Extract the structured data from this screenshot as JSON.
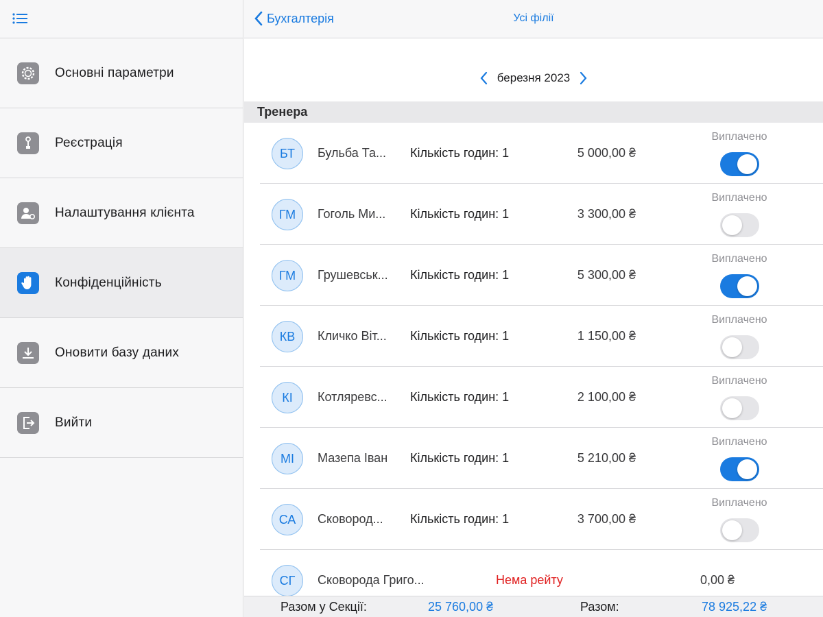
{
  "colors": {
    "accent": "#1a7be0",
    "danger": "#e02020",
    "icon_gray": "#8e8e93"
  },
  "sidebar": {
    "menu_icon": "list-icon",
    "items": [
      {
        "label": "Основні параметри",
        "icon": "gear-icon",
        "active": false
      },
      {
        "label": "Реєстрація",
        "icon": "key-icon",
        "active": false
      },
      {
        "label": "Налаштування клієнта",
        "icon": "user-settings-icon",
        "active": false
      },
      {
        "label": "Конфіденційність",
        "icon": "hand-icon",
        "active": true
      },
      {
        "label": "Оновити базу даних",
        "icon": "download-icon",
        "active": false
      },
      {
        "label": "Вийти",
        "icon": "logout-icon",
        "active": false
      }
    ]
  },
  "navbar": {
    "back_label": "Бухгалтерія",
    "title": "Усі філії"
  },
  "period": {
    "label": "березня 2023"
  },
  "section": {
    "title": "Тренера"
  },
  "trainers": [
    {
      "initials": "БТ",
      "name": "Бульба Та...",
      "hours": "Кількість годин: 1",
      "amount": "5 000,00 ₴",
      "paid_label": "Виплачено",
      "paid": true
    },
    {
      "initials": "ГМ",
      "name": "Гоголь Ми...",
      "hours": "Кількість годин: 1",
      "amount": "3 300,00 ₴",
      "paid_label": "Виплачено",
      "paid": false
    },
    {
      "initials": "ГМ",
      "name": "Грушевськ...",
      "hours": "Кількість годин: 1",
      "amount": "5 300,00 ₴",
      "paid_label": "Виплачено",
      "paid": true
    },
    {
      "initials": "КВ",
      "name": "Кличко Віт...",
      "hours": "Кількість годин: 1",
      "amount": "1 150,00 ₴",
      "paid_label": "Виплачено",
      "paid": false
    },
    {
      "initials": "КІ",
      "name": "Котляревс...",
      "hours": "Кількість годин: 1",
      "amount": "2 100,00 ₴",
      "paid_label": "Виплачено",
      "paid": false
    },
    {
      "initials": "МІ",
      "name": "Мазепа Іван",
      "hours": "Кількість годин: 1",
      "amount": "5 210,00 ₴",
      "paid_label": "Виплачено",
      "paid": true
    },
    {
      "initials": "СА",
      "name": "Сковород...",
      "hours": "Кількість годин: 1",
      "amount": "3 700,00 ₴",
      "paid_label": "Виплачено",
      "paid": false
    }
  ],
  "last_trainer": {
    "initials": "СГ",
    "name": "Сковорода Григо...",
    "status": "Нема рейту",
    "amount": "0,00 ₴"
  },
  "footer": {
    "section_total_label": "Разом у Секції:",
    "section_total_value": "25 760,00 ₴",
    "total_label": "Разом:",
    "total_value": "78 925,22 ₴"
  }
}
